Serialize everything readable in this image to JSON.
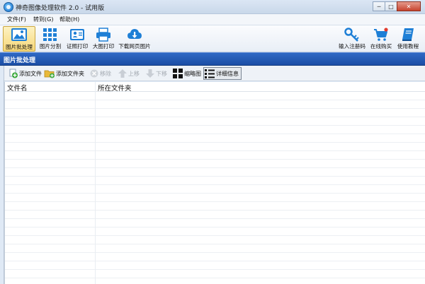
{
  "window": {
    "title": "神奇图像处理软件 2.0 - 试用版",
    "controls": {
      "minimize": "─",
      "maximize": "□",
      "close": "✕"
    }
  },
  "menu": [
    "文件(F)",
    "转到(G)",
    "帮助(H)"
  ],
  "toolbar": {
    "left": [
      {
        "label": "图片批处理",
        "icon": "image-icon",
        "active": true
      },
      {
        "label": "图片分割",
        "icon": "grid-icon",
        "active": false
      },
      {
        "label": "证照打印",
        "icon": "id-card-icon",
        "active": false
      },
      {
        "label": "大图打印",
        "icon": "printer-icon",
        "active": false
      },
      {
        "label": "下载网页图片",
        "icon": "cloud-download-icon",
        "active": false
      }
    ],
    "right": [
      {
        "label": "输入注册码",
        "icon": "key-icon"
      },
      {
        "label": "在线购买",
        "icon": "cart-icon"
      },
      {
        "label": "使用教程",
        "icon": "book-icon"
      }
    ]
  },
  "section": {
    "title": "图片批处理"
  },
  "subtoolbar": {
    "add_file": "添加文件",
    "add_folder": "添加文件夹",
    "remove": "移除",
    "move_up": "上移",
    "move_down": "下移",
    "thumbnail": "缩略图",
    "details": "详细信息"
  },
  "table": {
    "columns": [
      "文件名",
      "所在文件夹"
    ],
    "rows": []
  },
  "colors": {
    "section_bar": "#1b4ea5",
    "accent_blue": "#1e7fd6",
    "active_tool": "#f6d779",
    "add_green": "#3aa83a",
    "folder_yellow": "#e9b93a"
  }
}
